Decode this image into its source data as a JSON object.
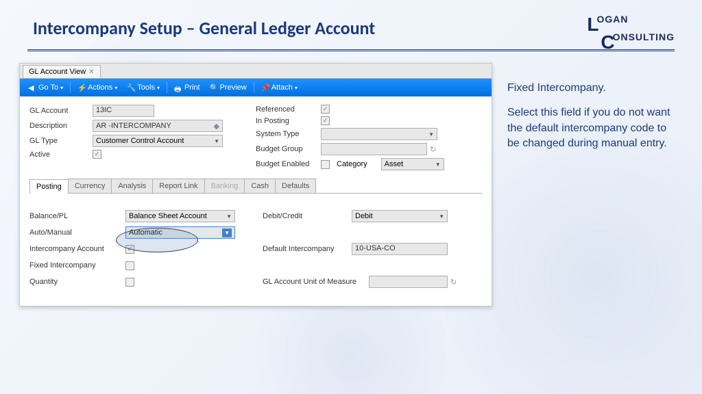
{
  "slide": {
    "title": "Intercompany Setup – General Ledger Account",
    "logo_line1a": "L",
    "logo_line1b": "OGAN",
    "logo_line2a": "C",
    "logo_line2b": "ONSULTING"
  },
  "window": {
    "tab_title": "GL Account View",
    "toolbar": {
      "goto": "Go To",
      "actions": "Actions",
      "tools": "Tools",
      "print": "Print",
      "preview": "Preview",
      "attach": "Attach"
    },
    "fields": {
      "gl_account_lbl": "GL Account",
      "gl_account_val": "13IC",
      "description_lbl": "Description",
      "description_val": "AR -INTERCOMPANY",
      "gl_type_lbl": "GL Type",
      "gl_type_val": "Customer Control Account",
      "active_lbl": "Active",
      "referenced_lbl": "Referenced",
      "in_posting_lbl": "In Posting",
      "system_type_lbl": "System Type",
      "budget_group_lbl": "Budget Group",
      "budget_enabled_lbl": "Budget Enabled",
      "category_lbl": "Category",
      "category_val": "Asset"
    },
    "subtabs": {
      "posting": "Posting",
      "currency": "Currency",
      "analysis": "Analysis",
      "report_link": "Report Link",
      "banking": "Banking",
      "cash": "Cash",
      "defaults": "Defaults"
    },
    "posting": {
      "balance_pl_lbl": "Balance/PL",
      "balance_pl_val": "Balance Sheet Account",
      "auto_manual_lbl": "Auto/Manual",
      "auto_manual_val": "Automatic",
      "intercompany_lbl": "Intercompany Account",
      "fixed_intercompany_lbl": "Fixed Intercompany",
      "quantity_lbl": "Quantity",
      "debit_credit_lbl": "Debit/Credit",
      "debit_credit_val": "Debit",
      "default_ic_lbl": "Default Intercompany",
      "default_ic_val": "10-USA-CO",
      "uom_lbl": "GL Account Unit of Measure"
    }
  },
  "annotation": {
    "heading": "Fixed Intercompany.",
    "body": "Select this field if you do not want the default intercompany code to be changed during manual entry."
  }
}
